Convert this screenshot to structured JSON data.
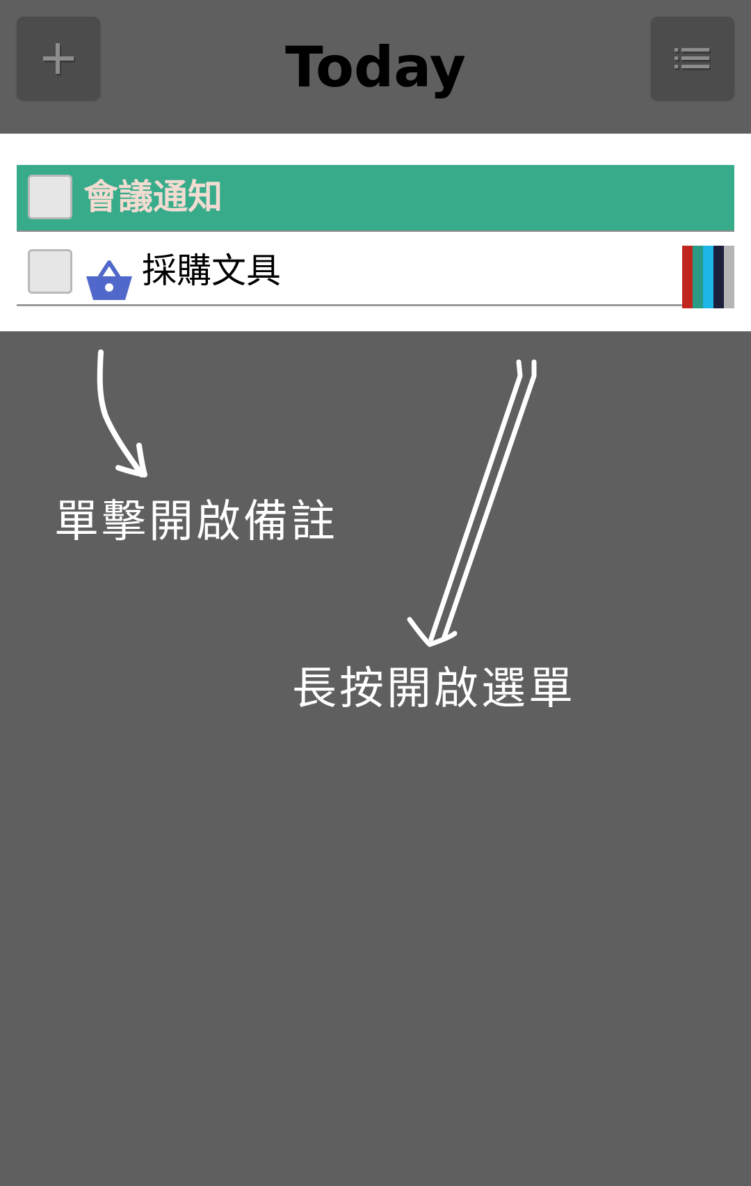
{
  "header": {
    "title": "Today",
    "add_button_icon": "plus-icon",
    "menu_button_icon": "list-icon"
  },
  "list": {
    "group": {
      "label": "會議通知",
      "background": "#37ab8a",
      "checked": false
    },
    "items": [
      {
        "label": "採購文具",
        "icon": "shopping-basket-icon",
        "icon_color": "#4f68c9",
        "checked": false,
        "tag_colors": [
          "#c0261e",
          "#2a9b84",
          "#1eb6e6",
          "#1b1f3b",
          "#b5b5b5"
        ]
      }
    ]
  },
  "annotations": {
    "tap_hint": "單擊開啟備註",
    "long_press_hint": "長按開啟選單"
  }
}
